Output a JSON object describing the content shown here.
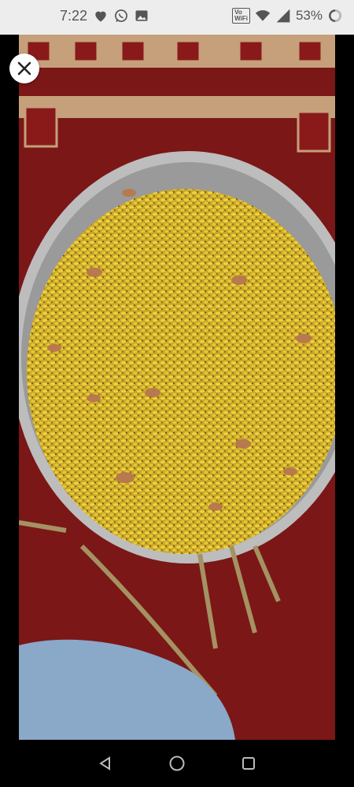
{
  "status_bar": {
    "time": "7:22",
    "battery": "53%",
    "left_icons": [
      "heart-icon",
      "whatsapp-icon",
      "gallery-icon"
    ],
    "right_icons": [
      "volte-wifi-icon",
      "wifi-icon",
      "signal-icon",
      "battery-icon"
    ],
    "volte_label_top": "Vo",
    "volte_label_bottom": "WiFi"
  },
  "viewer": {
    "image_subject": "steel bowl filled with mixed seeds and nuts on red carpet"
  },
  "navigation": {
    "buttons": [
      "back-button",
      "home-button",
      "recents-button"
    ]
  }
}
